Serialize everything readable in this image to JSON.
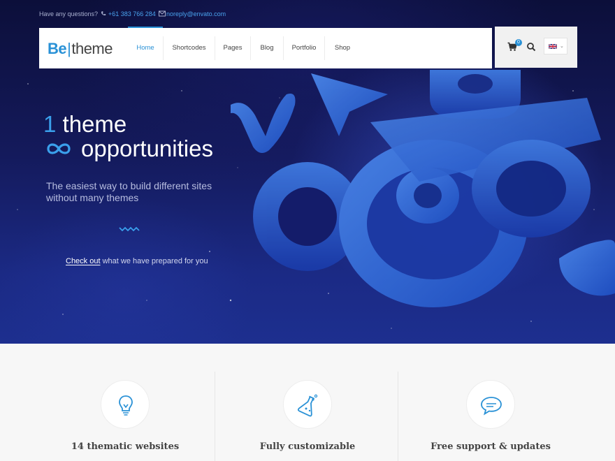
{
  "topbar": {
    "question": "Have any questions?",
    "phone": "+61 383 766 284",
    "email": "noreply@envato.com",
    "social_icons": [
      "facebook-icon",
      "google-plus-icon",
      "twitter-icon",
      "vimeo-icon",
      "youtube-icon",
      "flickr-icon",
      "linkedin-icon",
      "pinterest-icon",
      "dribbble-icon"
    ]
  },
  "logo": {
    "be": "Be",
    "sep": "|",
    "theme": "theme"
  },
  "nav": {
    "items": [
      {
        "label": "Home",
        "active": true
      },
      {
        "label": "Shortcodes",
        "active": false
      },
      {
        "label": "Pages",
        "active": false
      },
      {
        "label": "Blog",
        "active": false
      },
      {
        "label": "Portfolio",
        "active": false
      },
      {
        "label": "Shop",
        "active": false
      }
    ],
    "cart_count": "0",
    "language": "en-flag"
  },
  "hero": {
    "line1_num": "1",
    "line1_text": "theme",
    "line2_icon": "infinity-icon",
    "line2_text": "opportunities",
    "sub1": "The easiest way to build different sites",
    "sub2": "without many themes",
    "cta_link": "Check out",
    "cta_rest": " what we have prepared for you"
  },
  "features": [
    {
      "icon": "lightbulb-icon",
      "title": "14 thematic websites"
    },
    {
      "icon": "flask-icon",
      "title": "Fully customizable"
    },
    {
      "icon": "chat-bubble-icon",
      "title": "Free support & updates"
    }
  ],
  "colors": {
    "accent": "#2991d6",
    "hero_dark": "#0c0f3a",
    "hero_blue": "#1d2f8f"
  }
}
